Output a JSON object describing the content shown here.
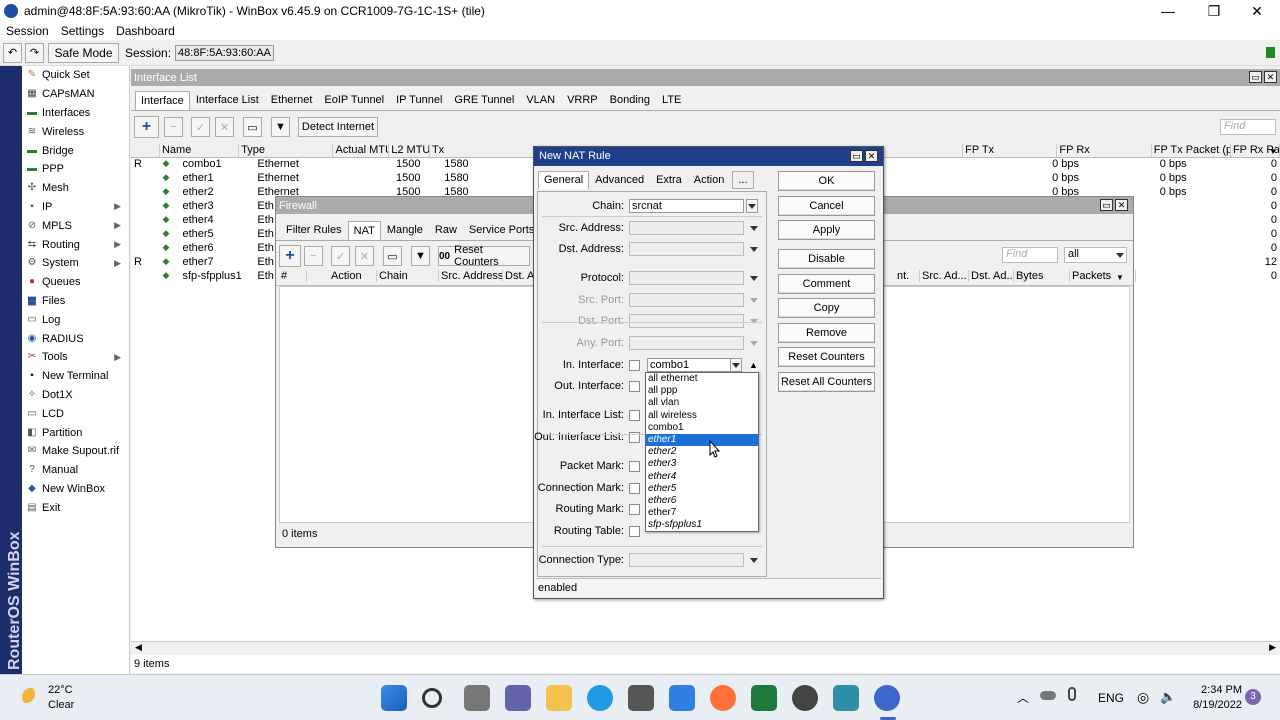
{
  "window": {
    "title": "admin@48:8F:5A:93:60:AA (MikroTik) - WinBox v6.45.9 on CCR1009-7G-1C-1S+ (tile)",
    "controls": {
      "minimize": "—",
      "maximize": "❐",
      "close": "✕"
    }
  },
  "menu": [
    "Session",
    "Settings",
    "Dashboard"
  ],
  "toolbar": {
    "undo": "↶",
    "redo": "↷",
    "safe_mode": "Safe Mode",
    "session_label": "Session:",
    "session_value": "48:8F:5A:93:60:AA"
  },
  "sidebar_brand": "RouterOS WinBox",
  "sidebar": [
    {
      "label": "Quick Set",
      "icon": "quick-set-icon",
      "glyph": "✎",
      "color": "#b07d2a",
      "submenu": false
    },
    {
      "label": "CAPsMAN",
      "icon": "capsman-icon",
      "glyph": "▦",
      "color": "#444",
      "submenu": false
    },
    {
      "label": "Interfaces",
      "icon": "interfaces-icon",
      "glyph": "▬",
      "color": "#2f7d2f",
      "submenu": false
    },
    {
      "label": "Wireless",
      "icon": "wireless-icon",
      "glyph": "≋",
      "color": "#555",
      "submenu": false
    },
    {
      "label": "Bridge",
      "icon": "bridge-icon",
      "glyph": "▬",
      "color": "#2f7d2f",
      "submenu": false
    },
    {
      "label": "PPP",
      "icon": "ppp-icon",
      "glyph": "▬",
      "color": "#2f7d2f",
      "submenu": false
    },
    {
      "label": "Mesh",
      "icon": "mesh-icon",
      "glyph": "✣",
      "color": "#555",
      "submenu": false
    },
    {
      "label": "IP",
      "icon": "ip-icon",
      "glyph": "255",
      "color": "#555",
      "submenu": true
    },
    {
      "label": "MPLS",
      "icon": "mpls-icon",
      "glyph": "⊘",
      "color": "#555",
      "submenu": true
    },
    {
      "label": "Routing",
      "icon": "routing-icon",
      "glyph": "⇆",
      "color": "#555",
      "submenu": true
    },
    {
      "label": "System",
      "icon": "system-icon",
      "glyph": "⚙",
      "color": "#555",
      "submenu": true
    },
    {
      "label": "Queues",
      "icon": "queues-icon",
      "glyph": "●",
      "color": "#b02a2a",
      "submenu": false
    },
    {
      "label": "Files",
      "icon": "files-icon",
      "glyph": "▆",
      "color": "#2a55a0",
      "submenu": false
    },
    {
      "label": "Log",
      "icon": "log-icon",
      "glyph": "▭",
      "color": "#555",
      "submenu": false
    },
    {
      "label": "RADIUS",
      "icon": "radius-icon",
      "glyph": "◉",
      "color": "#2a55a0",
      "submenu": false
    },
    {
      "label": "Tools",
      "icon": "tools-icon",
      "glyph": "✂",
      "color": "#a03030",
      "submenu": true
    },
    {
      "label": "New Terminal",
      "icon": "terminal-icon",
      "glyph": "▪",
      "color": "#222",
      "submenu": false
    },
    {
      "label": "Dot1X",
      "icon": "dot1x-icon",
      "glyph": "✧",
      "color": "#555",
      "submenu": false
    },
    {
      "label": "LCD",
      "icon": "lcd-icon",
      "glyph": "▭",
      "color": "#555",
      "submenu": false
    },
    {
      "label": "Partition",
      "icon": "partition-icon",
      "glyph": "◧",
      "color": "#555",
      "submenu": false
    },
    {
      "label": "Make Supout.rif",
      "icon": "supout-icon",
      "glyph": "✉",
      "color": "#555",
      "submenu": false
    },
    {
      "label": "Manual",
      "icon": "manual-icon",
      "glyph": "?",
      "color": "#2a55a0",
      "submenu": false
    },
    {
      "label": "New WinBox",
      "icon": "winbox-icon",
      "glyph": "◆",
      "color": "#2a55a0",
      "submenu": false
    },
    {
      "label": "Exit",
      "icon": "exit-icon",
      "glyph": "▤",
      "color": "#555",
      "submenu": false
    }
  ],
  "interface_list": {
    "title": "Interface List",
    "tabs": [
      "Interface",
      "Interface List",
      "Ethernet",
      "EoIP Tunnel",
      "IP Tunnel",
      "GRE Tunnel",
      "VLAN",
      "VRRP",
      "Bonding",
      "LTE"
    ],
    "detect_internet": "Detect Internet",
    "find_placeholder": "Find",
    "columns": [
      "Name",
      "Type",
      "Actual MTU",
      "L2 MTU",
      "Tx",
      "FP Tx",
      "FP Rx",
      "FP Tx Packet (p/s)",
      "FP Rx Pac"
    ],
    "rows": [
      {
        "flag": "R",
        "name": "combo1",
        "type": "Ethernet",
        "mtu": "1500",
        "l2mtu": "1580",
        "fptx": "0 bps",
        "fprx": "0 bps",
        "fptxp": "0"
      },
      {
        "flag": "",
        "name": "ether1",
        "type": "Ethernet",
        "mtu": "1500",
        "l2mtu": "1580",
        "fptx": "0 bps",
        "fprx": "0 bps",
        "fptxp": "0"
      },
      {
        "flag": "",
        "name": "ether2",
        "type": "Ethernet",
        "mtu": "1500",
        "l2mtu": "1580",
        "fptx": "0 bps",
        "fprx": "0 bps",
        "fptxp": "0"
      },
      {
        "flag": "",
        "name": "ether3",
        "type": "Eth",
        "mtu": "",
        "l2mtu": "",
        "fptx": "",
        "fprx": "",
        "fptxp": "0"
      },
      {
        "flag": "",
        "name": "ether4",
        "type": "Eth",
        "mtu": "",
        "l2mtu": "",
        "fptx": "",
        "fprx": "",
        "fptxp": "0"
      },
      {
        "flag": "",
        "name": "ether5",
        "type": "Eth",
        "mtu": "",
        "l2mtu": "",
        "fptx": "",
        "fprx": "",
        "fptxp": "0"
      },
      {
        "flag": "",
        "name": "ether6",
        "type": "Eth",
        "mtu": "",
        "l2mtu": "",
        "fptx": "",
        "fprx": "",
        "fptxp": "0"
      },
      {
        "flag": "R",
        "name": "ether7",
        "type": "Eth",
        "mtu": "",
        "l2mtu": "",
        "fptx": "",
        "fprx": "",
        "fptxp": "12"
      },
      {
        "flag": "",
        "name": "sfp-sfpplus1",
        "type": "Eth",
        "mtu": "",
        "l2mtu": "",
        "fptx": "",
        "fprx": "",
        "fptxp": "0"
      }
    ],
    "status": "9 items"
  },
  "firewall": {
    "title": "Firewall",
    "tabs": [
      "Filter Rules",
      "NAT",
      "Mangle",
      "Raw",
      "Service Ports"
    ],
    "reset_counters": "Reset Counters",
    "reset_prefix": "00",
    "find_placeholder": "Find",
    "filter_value": "all",
    "columns": [
      "#",
      "Action",
      "Chain",
      "Src. Address",
      "Dst. A",
      "nt.",
      "Src. Ad...",
      "Dst. Ad...",
      "Bytes",
      "Packets"
    ],
    "status": "0 items"
  },
  "nat_rule": {
    "title": "New NAT Rule",
    "tabs": [
      "General",
      "Advanced",
      "Extra",
      "Action",
      "..."
    ],
    "fields": {
      "chain": {
        "label": "Chain:",
        "value": "srcnat"
      },
      "src_address": {
        "label": "Src. Address:",
        "value": ""
      },
      "dst_address": {
        "label": "Dst. Address:",
        "value": ""
      },
      "protocol": {
        "label": "Protocol:",
        "value": ""
      },
      "src_port": {
        "label": "Src. Port:",
        "value": ""
      },
      "dst_port": {
        "label": "Dst. Port:",
        "value": ""
      },
      "any_port": {
        "label": "Any. Port:",
        "value": ""
      },
      "in_interface": {
        "label": "In. Interface:",
        "value": "combo1"
      },
      "out_interface": {
        "label": "Out. Interface:",
        "value": ""
      },
      "in_interface_list": {
        "label": "In. Interface List:",
        "value": ""
      },
      "out_interface_list": {
        "label": "Out. Interface List:",
        "value": ""
      },
      "packet_mark": {
        "label": "Packet Mark:",
        "value": ""
      },
      "connection_mark": {
        "label": "Connection Mark:",
        "value": ""
      },
      "routing_mark": {
        "label": "Routing Mark:",
        "value": ""
      },
      "routing_table": {
        "label": "Routing Table:",
        "value": ""
      },
      "connection_type": {
        "label": "Connection Type:",
        "value": ""
      }
    },
    "buttons": [
      "OK",
      "Cancel",
      "Apply",
      "Disable",
      "Comment",
      "Copy",
      "Remove",
      "Reset Counters",
      "Reset All Counters"
    ],
    "status": "enabled",
    "dropdown_options": [
      {
        "label": "all ethernet",
        "italic": false
      },
      {
        "label": "all ppp",
        "italic": false
      },
      {
        "label": "all vlan",
        "italic": false
      },
      {
        "label": "all wireless",
        "italic": false
      },
      {
        "label": "combo1",
        "italic": false
      },
      {
        "label": "ether1",
        "italic": true,
        "selected": true
      },
      {
        "label": "ether2",
        "italic": true
      },
      {
        "label": "ether3",
        "italic": true
      },
      {
        "label": "ether4",
        "italic": true
      },
      {
        "label": "ether5",
        "italic": true
      },
      {
        "label": "ether6",
        "italic": true
      },
      {
        "label": "ether7",
        "italic": false
      },
      {
        "label": "sfp-sfpplus1",
        "italic": true
      }
    ]
  },
  "taskbar": {
    "weather_temp": "22°C",
    "weather_desc": "Clear",
    "lang": "ENG",
    "time": "2:34 PM",
    "date": "8/19/2022",
    "notif_count": "3"
  },
  "colors": {
    "selection": "#1a6fd8",
    "sidebar_strip": "#1d2d6b",
    "mdi_title": "#ababab",
    "dialog_title": "#1f3f8a",
    "accent_green": "#1c8a1c"
  }
}
